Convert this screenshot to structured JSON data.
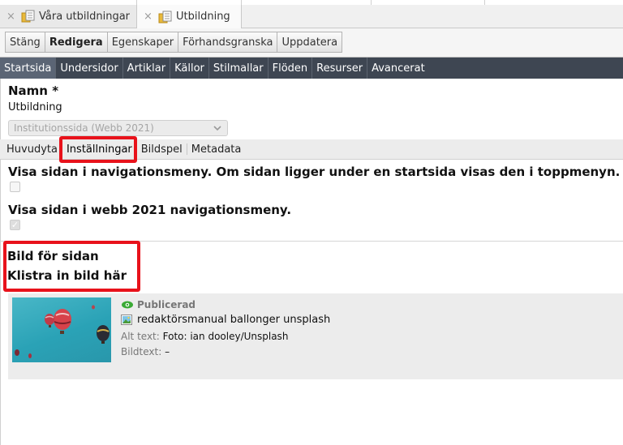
{
  "doc_tabs": [
    {
      "label": "Våra utbildningar",
      "close": "×"
    },
    {
      "label": "Utbildning",
      "close": "×"
    }
  ],
  "toolbar": [
    "Stäng",
    "Redigera",
    "Egenskaper",
    "Förhandsgranska",
    "Uppdatera"
  ],
  "nav": [
    "Startsida",
    "Undersidor",
    "Artiklar",
    "Källor",
    "Stilmallar",
    "Flöden",
    "Resurser",
    "Avancerat"
  ],
  "name": {
    "label": "Namn *",
    "value": "Utbildning",
    "template_select": "Institutionssida (Webb 2021)"
  },
  "subtabs": [
    "Huvudyta",
    "Inställningar",
    "Bildspel",
    "Metadata"
  ],
  "settings": {
    "nav_menu_label": "Visa sidan i navigationsmeny. Om sidan ligger under en startsida visas den i toppmenyn. I a",
    "nav_menu_checked": false,
    "webb2021_label": "Visa sidan i webb 2021 navigationsmeny.",
    "webb2021_checked": true
  },
  "image": {
    "section_title": "Bild för sidan",
    "paste_hint": "Klistra in bild här",
    "status": "Publicerad",
    "file_name": "redaktörsmanual ballonger unsplash",
    "alt_label": "Alt text:",
    "alt_value": "Foto: ian dooley/Unsplash",
    "caption_label": "Bildtext:",
    "caption_value": "–"
  },
  "colors": {
    "navbar": "#3e4652",
    "highlight": "#e8121b",
    "published": "#3aaa35"
  }
}
